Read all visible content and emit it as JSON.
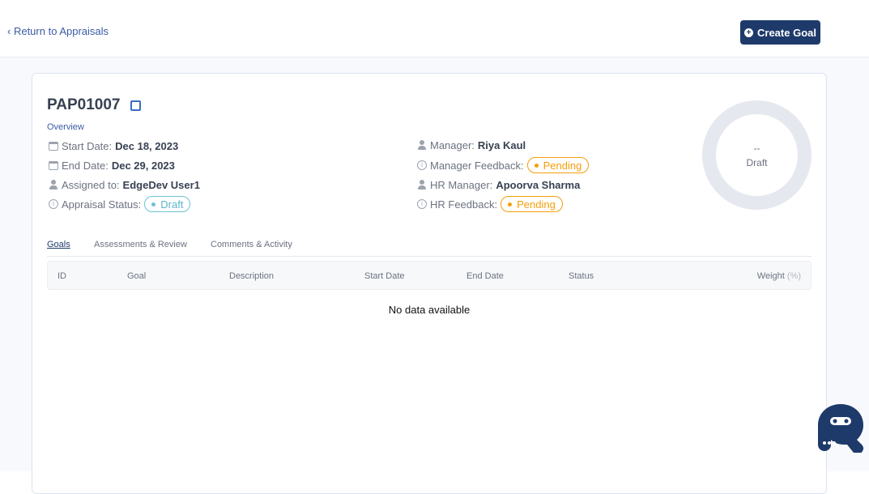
{
  "header": {
    "back_label": "Return to Appraisals",
    "create_label": "Create Goal"
  },
  "appraisal": {
    "id": "PAP01007",
    "overview_label": "Overview",
    "start_date_label": "Start Date:",
    "start_date": "Dec 18, 2023",
    "end_date_label": "End Date:",
    "end_date": "Dec 29, 2023",
    "assigned_label": "Assigned to:",
    "assigned": "EdgeDev User1",
    "status_label": "Appraisal Status:",
    "status": "Draft",
    "manager_label": "Manager:",
    "manager": "Riya Kaul",
    "manager_feedback_label": "Manager Feedback:",
    "manager_feedback": "Pending",
    "hr_manager_label": "HR Manager:",
    "hr_manager": "Apoorva Sharma",
    "hr_feedback_label": "HR Feedback:",
    "hr_feedback": "Pending"
  },
  "donut": {
    "value": "--",
    "label": "Draft"
  },
  "tabs": [
    {
      "label": "Goals"
    },
    {
      "label": "Assessments & Review"
    },
    {
      "label": "Comments & Activity"
    }
  ],
  "table": {
    "columns": [
      "ID",
      "Goal",
      "Description",
      "Start Date",
      "End Date",
      "Status",
      "Weight"
    ],
    "weight_unit": "(%)",
    "empty": "No data available"
  },
  "colors": {
    "primary": "#1e3a6b",
    "draft": "#6cc3d6",
    "pending": "#f59e0b"
  }
}
